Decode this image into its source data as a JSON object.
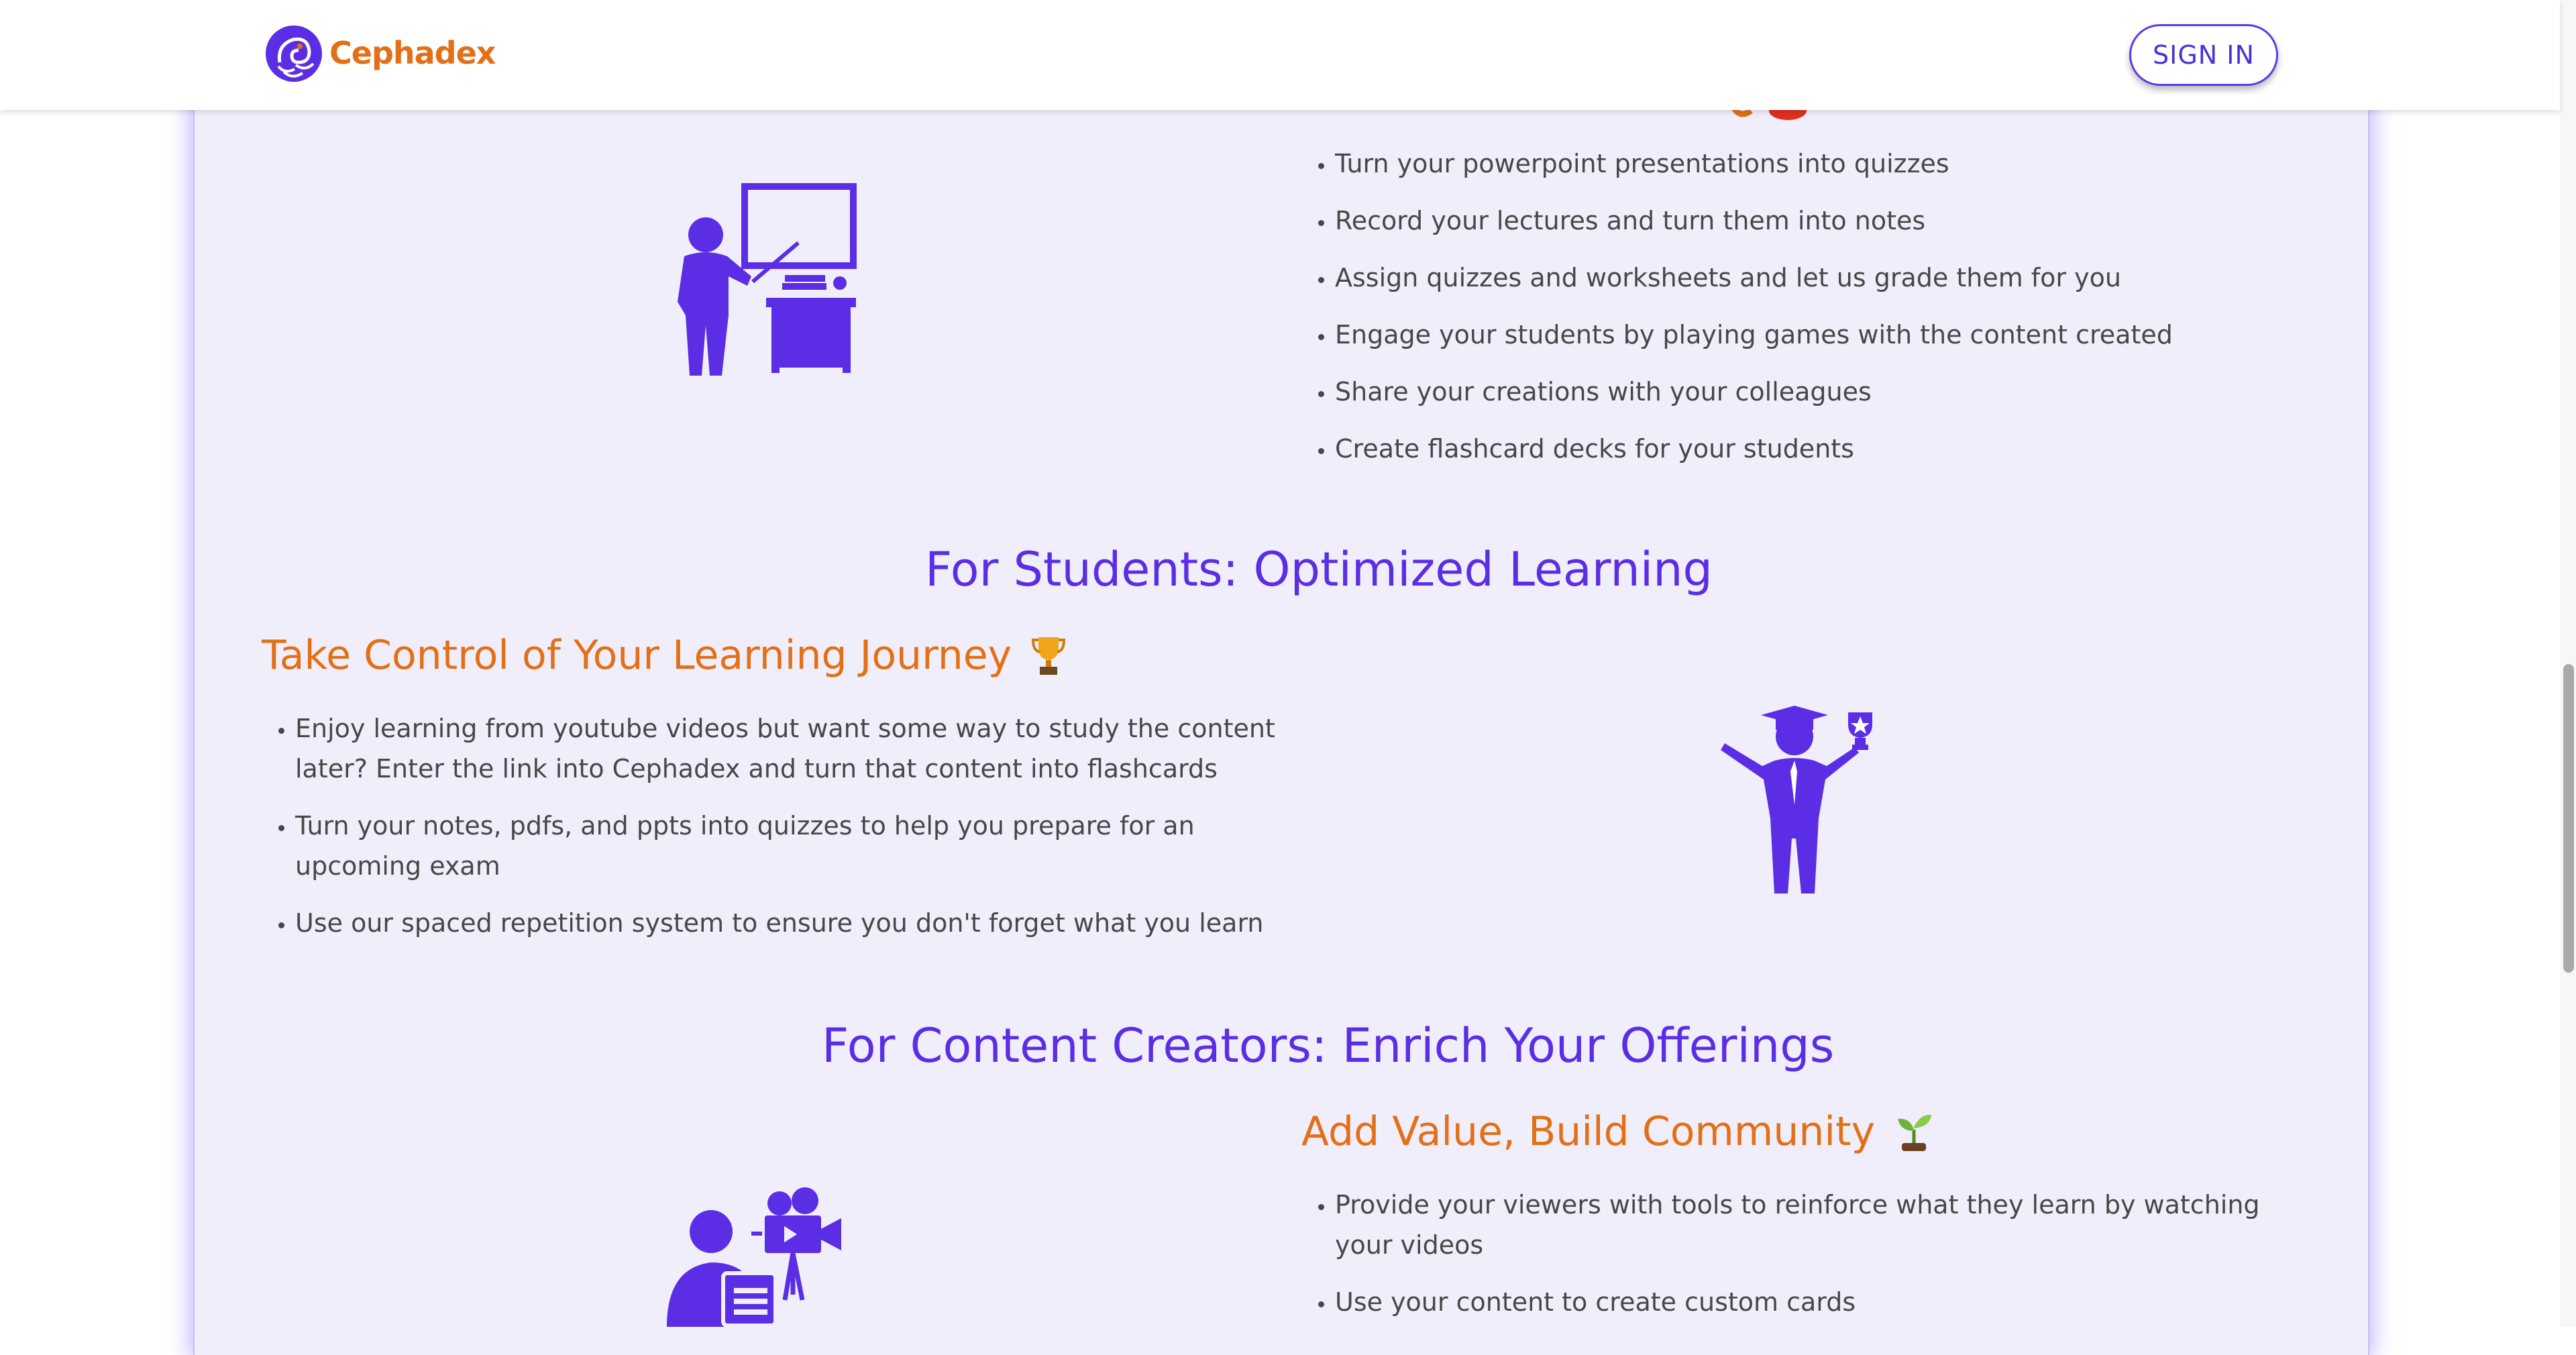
{
  "header": {
    "brand": "Cephadex",
    "signin_label": "SIGN IN"
  },
  "teachers": {
    "bullets": [
      "Turn your powerpoint presentations into quizzes",
      "Record your lectures and turn them into notes",
      "Assign quizzes and worksheets and let us grade them for you",
      "Engage your students by playing games with the content created",
      "Share your creations with your colleagues",
      "Create flashcard decks for your students"
    ]
  },
  "students": {
    "title": "For Students: Optimized Learning",
    "subtitle": "Take Control of Your Learning Journey",
    "subtitle_emoji": "trophy-icon",
    "bullets": [
      "Enjoy learning from youtube videos but want some way to study the content later? Enter the link into Cephadex and turn that content into flashcards",
      "Turn your notes, pdfs, and ppts into quizzes to help you prepare for an upcoming exam",
      "Use our spaced repetition system to ensure you don't forget what you learn"
    ]
  },
  "creators": {
    "title": "For Content Creators: Enrich Your Offerings",
    "subtitle": "Add Value, Build Community",
    "subtitle_emoji": "seedling-icon",
    "bullets": [
      "Provide your viewers with tools to reinforce what they learn by watching your videos",
      "Use your content to create custom cards"
    ]
  },
  "colors": {
    "brand_orange": "#e36f17",
    "accent_purple": "#5b2de5",
    "panel_bg": "#f1eefb"
  }
}
